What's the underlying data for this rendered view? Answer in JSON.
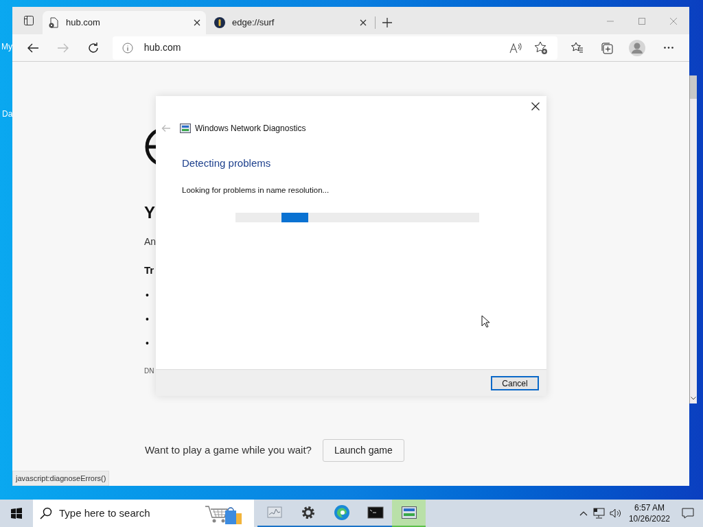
{
  "desktop": {
    "icon_labels": [
      "My",
      "Da"
    ]
  },
  "browser": {
    "tabs": [
      {
        "title": "hub.com",
        "selected": true,
        "kind": "page"
      },
      {
        "title": "edge://surf",
        "selected": false,
        "kind": "surf"
      }
    ],
    "address": "hub.com",
    "page": {
      "heading": "Y",
      "paragraph": "An",
      "subheading": "Tr",
      "bullets": [
        "•",
        "•",
        "•"
      ],
      "code": "DN",
      "game_prompt": "Want to play a game while you wait?",
      "game_button": "Launch game"
    },
    "status_link": "javascript:diagnoseErrors()"
  },
  "dialog": {
    "title": "Windows Network Diagnostics",
    "heading": "Detecting problems",
    "message": "Looking for problems in name resolution...",
    "cancel": "Cancel"
  },
  "taskbar": {
    "search_placeholder": "Type here to search",
    "apps": [
      {
        "kind": "monitor",
        "active": false
      },
      {
        "kind": "settings",
        "active": false
      },
      {
        "kind": "edge",
        "active": false
      },
      {
        "kind": "terminal",
        "active": false
      },
      {
        "kind": "diagnostics",
        "active": true
      }
    ],
    "time": "6:57 AM",
    "date": "10/26/2022"
  }
}
